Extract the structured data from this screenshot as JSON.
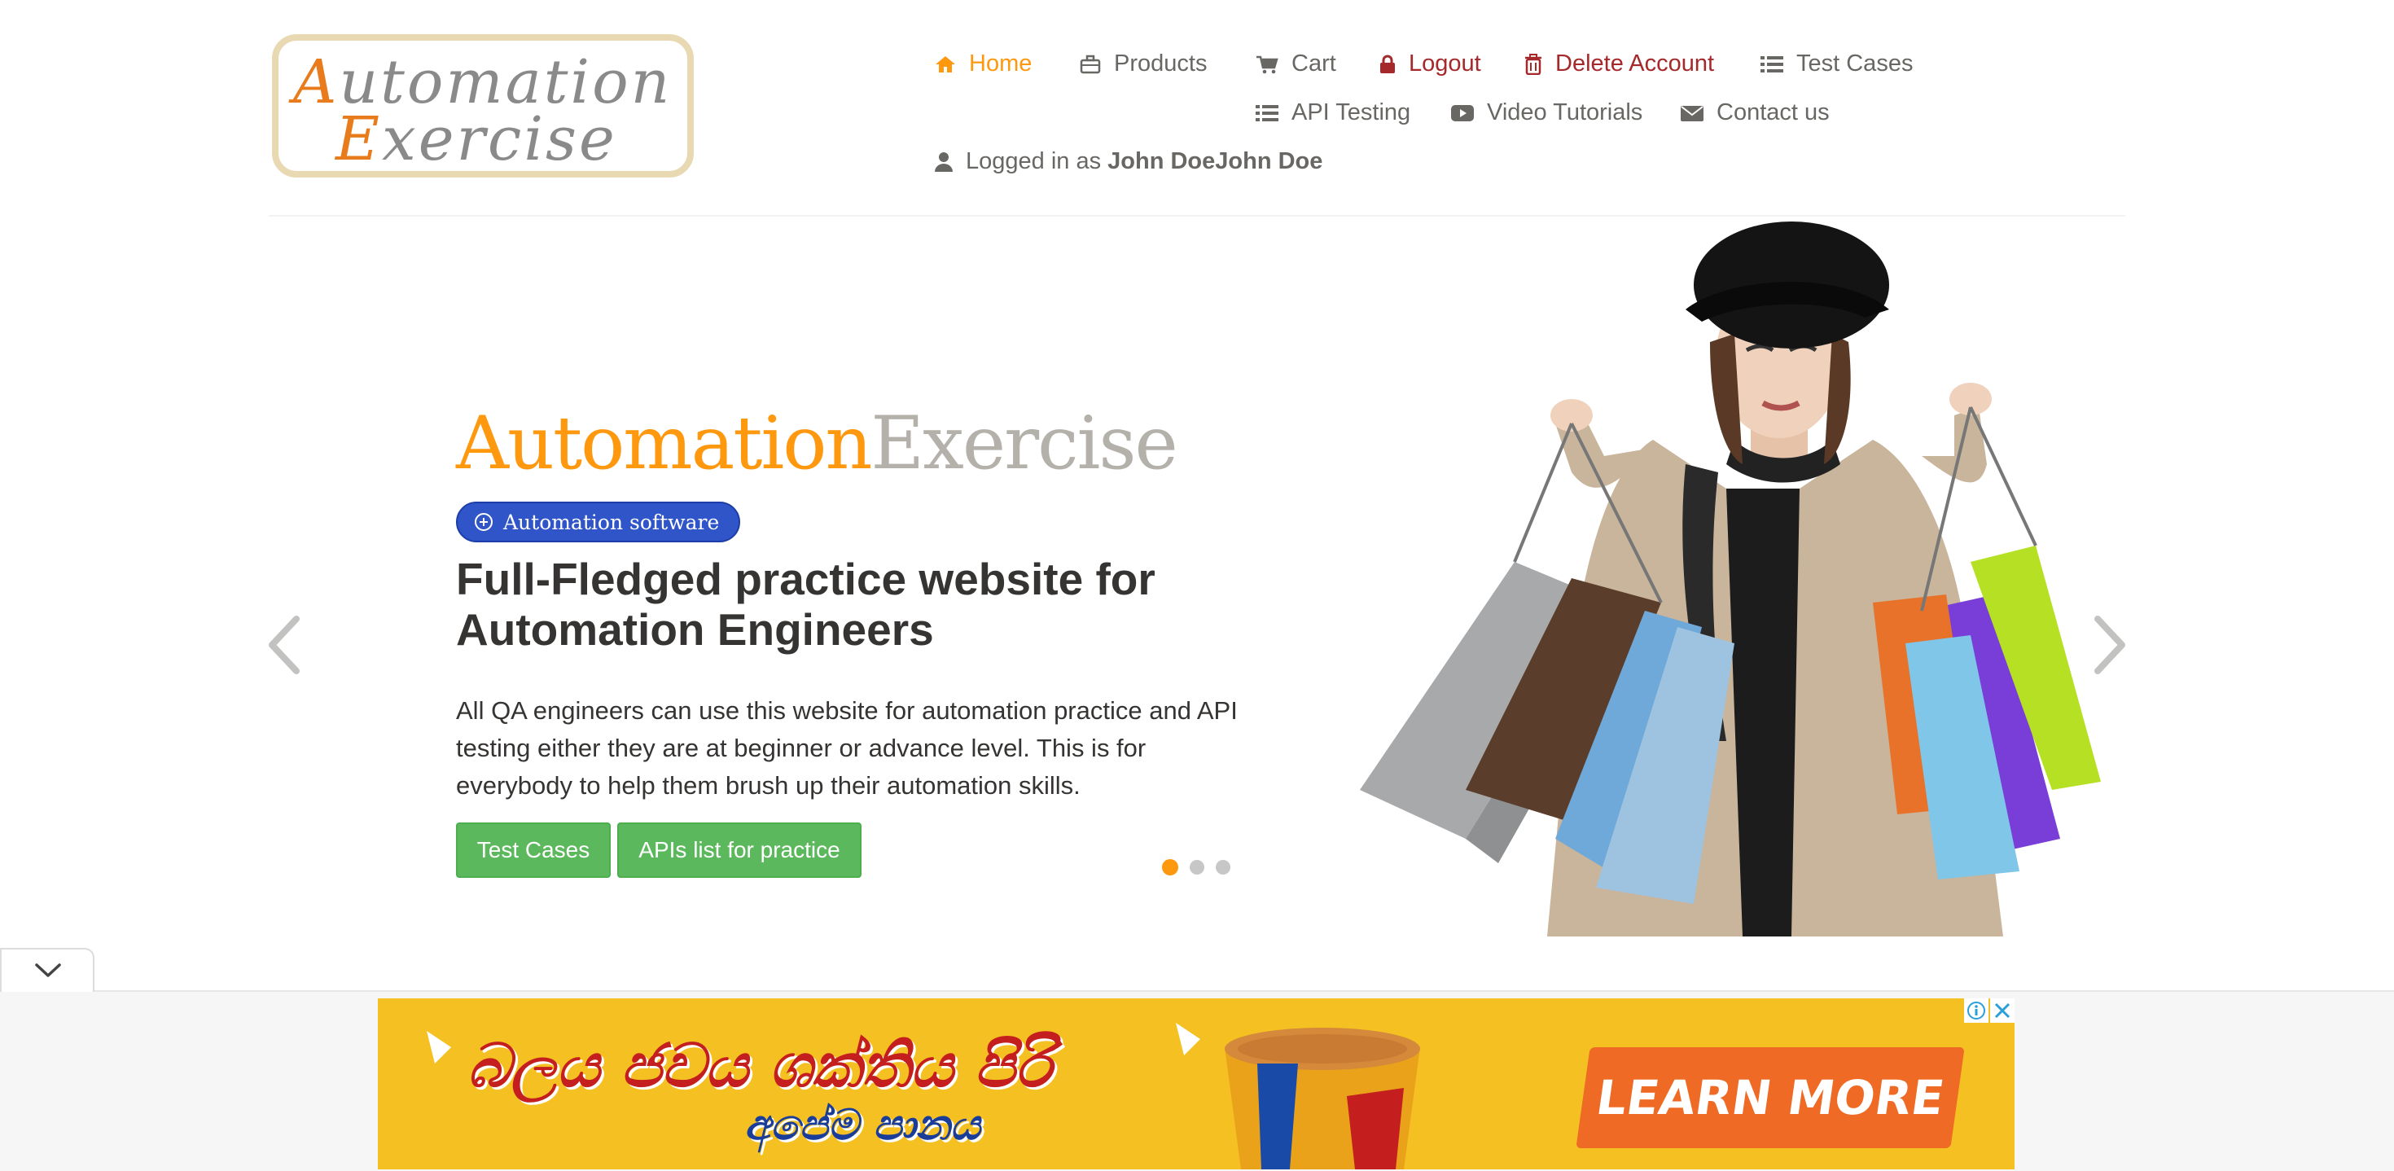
{
  "logo": {
    "line1": "Automation",
    "line2": "Exercise"
  },
  "nav": {
    "home": "Home",
    "products": "Products",
    "cart": "Cart",
    "logout": "Logout",
    "delete_account": "Delete Account",
    "test_cases": "Test Cases",
    "api_testing": "API Testing",
    "video_tutorials": "Video Tutorials",
    "contact_us": "Contact us",
    "logged_in_prefix": "Logged in as",
    "logged_in_user": "John DoeJohn Doe"
  },
  "hero": {
    "title_part1": "Automation",
    "title_part2": "Exercise",
    "badge": "Automation software",
    "headline": "Full-Fledged practice website for Automation Engineers",
    "description": "All QA engineers can use this website for automation practice and API testing either they are at beginner or advance level. This is for everybody to help them brush up their automation skills.",
    "btn_test_cases": "Test Cases",
    "btn_apis": "APIs list for practice",
    "carousel_slides": 3,
    "carousel_active": 1
  },
  "ad": {
    "line1": "බලය ජවය ශක්තිය පිරි",
    "line2": "අපේම පානය",
    "cta": "LEARN MORE"
  },
  "colors": {
    "accent": "#fe980f",
    "danger": "#a5292a",
    "button_green": "#5cb85c",
    "badge_blue": "#2f55c9",
    "ad_yellow": "#f4c022",
    "ad_cta": "#ef6a24"
  },
  "icons": [
    "home-icon",
    "briefcase-icon",
    "cart-icon",
    "lock-icon",
    "trash-icon",
    "list-icon",
    "video-icon",
    "envelope-icon",
    "user-icon",
    "plus-circle-icon",
    "chevron-left-icon",
    "chevron-right-icon",
    "chevron-down-icon",
    "info-icon",
    "close-icon"
  ]
}
